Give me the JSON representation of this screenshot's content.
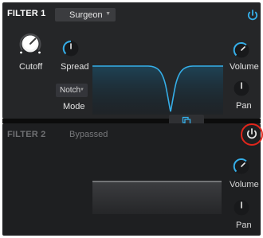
{
  "filter1": {
    "title": "FILTER 1",
    "type_value": "Surgeon",
    "power_on": true,
    "knobs": {
      "cutoff_label": "Cutoff",
      "spread_label": "Spread",
      "volume_label": "Volume",
      "pan_label": "Pan"
    },
    "mode": {
      "value": "Notch",
      "label": "Mode"
    }
  },
  "filter2": {
    "title": "FILTER 2",
    "status": "Bypassed",
    "power_on": false,
    "knobs": {
      "volume_label": "Volume",
      "pan_label": "Pan"
    }
  },
  "colors": {
    "accent": "#35aee8",
    "panel1": "#252628",
    "panel2": "#1e1f21",
    "highlight_ring": "#e1261c"
  },
  "icons": {
    "power": "power-icon",
    "link": "link-icon",
    "dropdown": "chevron-down-icon"
  }
}
